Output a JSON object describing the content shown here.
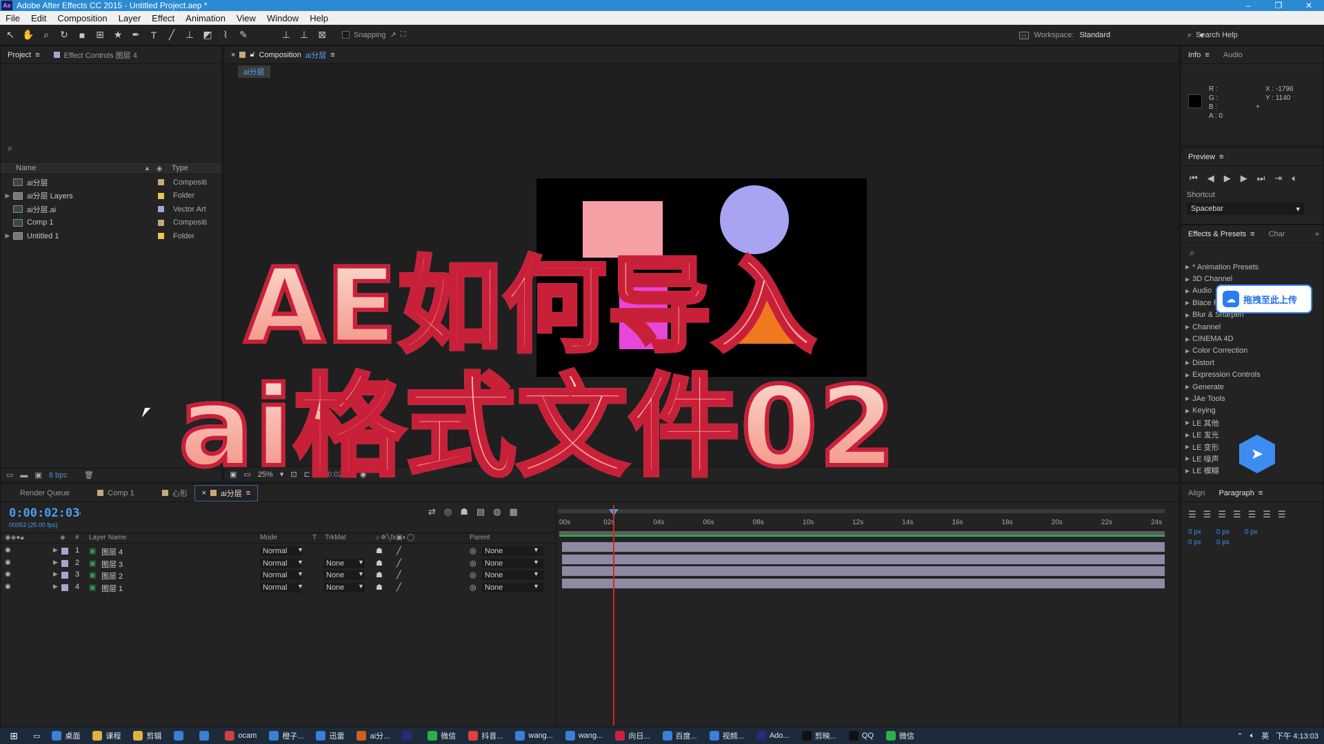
{
  "window": {
    "title": "Adobe After Effects CC 2015 - Untitled Project.aep *",
    "app_badge": "Ae",
    "minimize": "–",
    "maximize": "❐",
    "close": "✕"
  },
  "menu": [
    "File",
    "Edit",
    "Composition",
    "Layer",
    "Effect",
    "Animation",
    "View",
    "Window",
    "Help"
  ],
  "toolbar": {
    "snapping": "Snapping",
    "workspace_label": "Workspace:",
    "workspace_value": "Standard",
    "search_help": "Search Help"
  },
  "project_panel": {
    "tabs": [
      "Project",
      "Effect Controls 图层 4"
    ],
    "columns": {
      "name": "Name",
      "type": "Type"
    },
    "items": [
      {
        "name": "ai分层",
        "type": "Compositi",
        "label_color": "#c8a878",
        "kind": "comp",
        "expandable": false
      },
      {
        "name": "ai分层 Layers",
        "type": "Folder",
        "label_color": "#e6c84a",
        "kind": "folder",
        "expandable": true
      },
      {
        "name": "ai分层.ai",
        "type": "Vector Art",
        "label_color": "#a9a3cf",
        "kind": "file",
        "expandable": false
      },
      {
        "name": "Comp 1",
        "type": "Compositi",
        "label_color": "#c8a878",
        "kind": "comp",
        "expandable": false
      },
      {
        "name": "Untitled 1",
        "type": "Folder",
        "label_color": "#e6c84a",
        "kind": "folder",
        "expandable": true
      }
    ],
    "footer_bpc": "8 bpc"
  },
  "comp_panel": {
    "tab_prefix": "Composition",
    "tab_name": "ai分层",
    "sub_tab": "ai分层",
    "zoom": "25%",
    "timecode": "0:00:02:03"
  },
  "overlay_text": {
    "line1": "AE如何导入",
    "line2": "ai格式文件02"
  },
  "info_panel": {
    "tabs": [
      "Info",
      "Audio"
    ],
    "r": "R :",
    "g": "G :",
    "b": "B :",
    "a": "A : 0",
    "x": "X : -1796",
    "y": "Y : 1140"
  },
  "preview_panel": {
    "title": "Preview",
    "shortcut_label": "Shortcut",
    "shortcut_value": "Spacebar"
  },
  "effects_panel": {
    "tabs": [
      "Effects & Presets",
      "Char"
    ],
    "items": [
      "* Animation Presets",
      "3D Channel",
      "Audio",
      "Blace P",
      "Blur & Sharpen",
      "Channel",
      "CINEMA 4D",
      "Color Correction",
      "Distort",
      "Expression Controls",
      "Generate",
      "JAe Tools",
      "Keying",
      "LE 其他",
      "LE 发光",
      "LE 变形",
      "LE 噪声",
      "LE 模糊"
    ],
    "upload_badge": "拖拽至此上传"
  },
  "timeline": {
    "tabs": [
      "Render Queue",
      "Comp 1",
      "心形",
      "ai分层"
    ],
    "timecode": "0:00:02:03",
    "timecode_sub": "00053 (25.00 fps)",
    "headers": {
      "num": "#",
      "layer_name": "Layer Name",
      "mode": "Mode",
      "t": "T",
      "trkmat": "TrkMat",
      "parent": "Parent"
    },
    "layers": [
      {
        "num": "1",
        "name": "图层 4",
        "mode": "Normal",
        "trkmat": "",
        "parent": "None"
      },
      {
        "num": "2",
        "name": "图层 3",
        "mode": "Normal",
        "trkmat": "None",
        "parent": "None"
      },
      {
        "num": "3",
        "name": "图层 2",
        "mode": "Normal",
        "trkmat": "None",
        "parent": "None"
      },
      {
        "num": "4",
        "name": "图层 1",
        "mode": "Normal",
        "trkmat": "None",
        "parent": "None"
      }
    ],
    "ruler_ticks": [
      "00s",
      "02s",
      "04s",
      "06s",
      "08s",
      "10s",
      "12s",
      "14s",
      "16s",
      "18s",
      "20s",
      "22s",
      "24s"
    ]
  },
  "paragraph_panel": {
    "tabs": [
      "Align",
      "Paragraph"
    ],
    "indent_values": [
      "0 px",
      "0 px",
      "0 px",
      "0 px",
      "0 px"
    ]
  },
  "taskbar": {
    "items": [
      {
        "label": "桌面",
        "color": "#3c7fd6"
      },
      {
        "label": "课程",
        "color": "#e0b040"
      },
      {
        "label": "剪辑",
        "color": "#e0b040"
      },
      {
        "label": "",
        "color": "#3c7fd6"
      },
      {
        "label": "",
        "color": "#3c7fd6"
      },
      {
        "label": "ocam",
        "color": "#d04040"
      },
      {
        "label": "橙子...",
        "color": "#3c7fd6"
      },
      {
        "label": "迅雷",
        "color": "#3c7fd6"
      },
      {
        "label": "ai分...",
        "color": "#d06020"
      },
      {
        "label": "",
        "color": "#2a2a7a"
      },
      {
        "label": "微信",
        "color": "#2ab04a"
      },
      {
        "label": "抖音...",
        "color": "#e04040"
      },
      {
        "label": "wang...",
        "color": "#3c7fd6"
      },
      {
        "label": "wang...",
        "color": "#3c7fd6"
      },
      {
        "label": "向日...",
        "color": "#d02040"
      },
      {
        "label": "百度...",
        "color": "#3c7fd6"
      },
      {
        "label": "视频...",
        "color": "#3c7fd6"
      },
      {
        "label": "Ado...",
        "color": "#2a2a7a"
      },
      {
        "label": "剪映...",
        "color": "#111111"
      },
      {
        "label": "QQ",
        "color": "#111111"
      },
      {
        "label": "微信",
        "color": "#2ab04a"
      }
    ],
    "lang": "英",
    "clock": "下午 4:13:03"
  }
}
